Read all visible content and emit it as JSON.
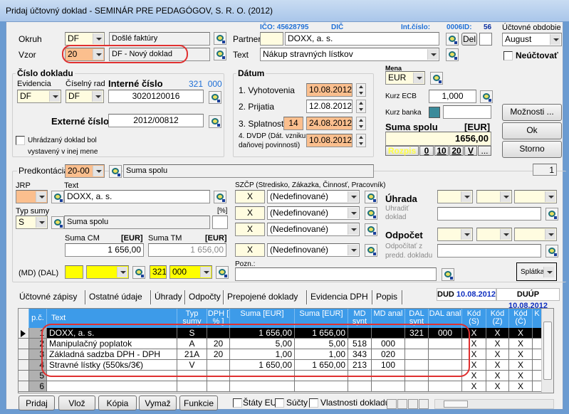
{
  "window": {
    "title": "Pridaj účtovný doklad - SEMINÁR PRE PEDAGÓGOV, S. R. O. (2012)"
  },
  "header": {
    "okruh_label": "Okruh",
    "okruh_value": "DF",
    "okruh_text": "Došlé faktúry",
    "vzor_label": "Vzor",
    "vzor_value": "20",
    "vzor_text": "DF - Nový doklad",
    "ico": "IČO: 45628795",
    "dic": "DIČ",
    "int_cislo": "Int.číslo:",
    "id_label": "0006ID:",
    "id_value": "56",
    "partner_label": "Partner",
    "partner_value": "DOXX, a. s.",
    "del_label": "Del",
    "text_label": "Text",
    "text_value": "Nákup stravných lístkov",
    "obdobie_label": "Účtovné obdobie",
    "obdobie_value": "August",
    "neuctovat_label": "Neúčtovať"
  },
  "cislo": {
    "title": "Číslo dokladu",
    "evidencia_label": "Evidencia",
    "evidencia_value": "DF",
    "rad_label": "Číselný rad",
    "rad_value": "DF",
    "interne_label": "Interné číslo",
    "ucet": "321  000",
    "interne_value": "3020120016",
    "externe_label": "Externé číslo",
    "externe_value": "2012/00812",
    "mena_check_1": "Uhrádzaný doklad bol",
    "mena_check_2": "vystavený v inej mene"
  },
  "datum": {
    "title": "Dátum",
    "rows": [
      {
        "label": "1. Vyhotovenia",
        "value": "10.08.2012"
      },
      {
        "label": "2. Prijatia",
        "value": "12.08.2012"
      },
      {
        "label": "3. Splatnosti",
        "days": "14",
        "value": "24.08.2012"
      },
      {
        "label1": "4. DVDP (Dát. vzniku",
        "label2": "daňovej povinnosti)",
        "value": "10.08.2012"
      }
    ]
  },
  "mena": {
    "label": "Mena",
    "value": "EUR",
    "kurz_ecb_label": "Kurz ECB",
    "kurz_ecb": "1,000",
    "kurz_banka_label": "Kurz banka",
    "kurz_banka": "",
    "suma_label": "Suma spolu",
    "suma_unit": "[EUR]",
    "suma": "1656,00",
    "rozpis": "Rozpis",
    "quick": [
      "0",
      "10",
      "20",
      "V",
      "..."
    ]
  },
  "buttons": {
    "moznosti": "Možnosti ...",
    "ok": "Ok",
    "storno": "Storno",
    "page": "1"
  },
  "pred": {
    "label": "Predkontácia",
    "value": "20-00",
    "text": "Suma spolu",
    "jrp_label": "JRP",
    "text_label": "Text",
    "text_value": "DOXX, a. s.",
    "typ_label": "Typ sumy",
    "typ_value": "S",
    "typ_text": "Suma spolu",
    "pct_label": "[%]",
    "suma_cm_label": "Suma CM",
    "suma_tm_label": "Suma TM",
    "unit": "[EUR]",
    "suma_cm": "1 656,00",
    "suma_tm": "1 656,00",
    "mddal_label": "(MD) (DAL)",
    "dal_syn": "321",
    "dal_anal": "000"
  },
  "szcp": {
    "label": "SZČP (Stredisko, Zákazka, Činnosť, Pracovník)",
    "rows": [
      {
        "code": "X",
        "value": "(Nedefinované)"
      },
      {
        "code": "X",
        "value": "(Nedefinované)"
      },
      {
        "code": "X",
        "value": "(Nedefinované)"
      },
      {
        "code": "X",
        "value": "(Nedefinované)"
      }
    ],
    "pozn_label": "Pozn.:"
  },
  "uhrada": {
    "label": "Úhrada",
    "sub1": "Uhradiť",
    "sub2": "doklad",
    "odpocet_label": "Odpočet",
    "osub1": "Odpočítať z",
    "osub2": "predd. dokladu",
    "splatka": "Splátka"
  },
  "tabs": {
    "items": [
      "Účtovné zápisy",
      "Ostatné údaje",
      "Úhrady",
      "Odpočty",
      "Prepojené doklady",
      "Evidencia DPH",
      "Popis"
    ],
    "dud_label": "DUD",
    "dud": "10.08.2012",
    "duup_label": "DUÚP",
    "duup": "10.08.2012"
  },
  "grid": {
    "columns": [
      "p.č.",
      "Text",
      "Typ sumy",
      "DPH [ % ]",
      "Suma [EUR]",
      "Suma [EUR]",
      "MD synt",
      "MD anal",
      "DAL synt",
      "DAL anal",
      "Kód (S)",
      "Kód (Z)",
      "Kód (Č)",
      "K"
    ],
    "rows": [
      [
        "1",
        "DOXX, a. s.",
        "S",
        "",
        "1 656,00",
        "1 656,00",
        "",
        "",
        "321",
        "000",
        "X",
        "X",
        "X",
        ""
      ],
      [
        "2",
        "Manipulačný poplatok",
        "A",
        "20",
        "5,00",
        "5,00",
        "518",
        "000",
        "",
        "",
        "X",
        "X",
        "X",
        ""
      ],
      [
        "3",
        "Základná sadzba DPH - DPH",
        "21A",
        "20",
        "1,00",
        "1,00",
        "343",
        "020",
        "",
        "",
        "X",
        "X",
        "X",
        ""
      ],
      [
        "4",
        "Stravné lístky (550ks/3€)",
        "V",
        "",
        "1 650,00",
        "1 650,00",
        "213",
        "100",
        "",
        "",
        "X",
        "X",
        "X",
        ""
      ],
      [
        "5",
        "",
        "",
        "",
        "",
        "",
        "",
        "",
        "",
        "",
        "X",
        "X",
        "X",
        ""
      ],
      [
        "6",
        "",
        "",
        "",
        "",
        "",
        "",
        "",
        "",
        "",
        "X",
        "X",
        "X",
        ""
      ]
    ]
  },
  "footer": {
    "buttons": [
      "Pridaj",
      "Vlož",
      "Kópia",
      "Vymaž",
      "Funkcie"
    ],
    "checks": [
      "Štáty EU",
      "Súčty",
      "Vlastnosti dokladu"
    ]
  },
  "colors": {
    "header_blue": "#3d9be9",
    "highlight": "#e03030",
    "orange": "#fbbf8e",
    "yellow": "#ffff00"
  }
}
